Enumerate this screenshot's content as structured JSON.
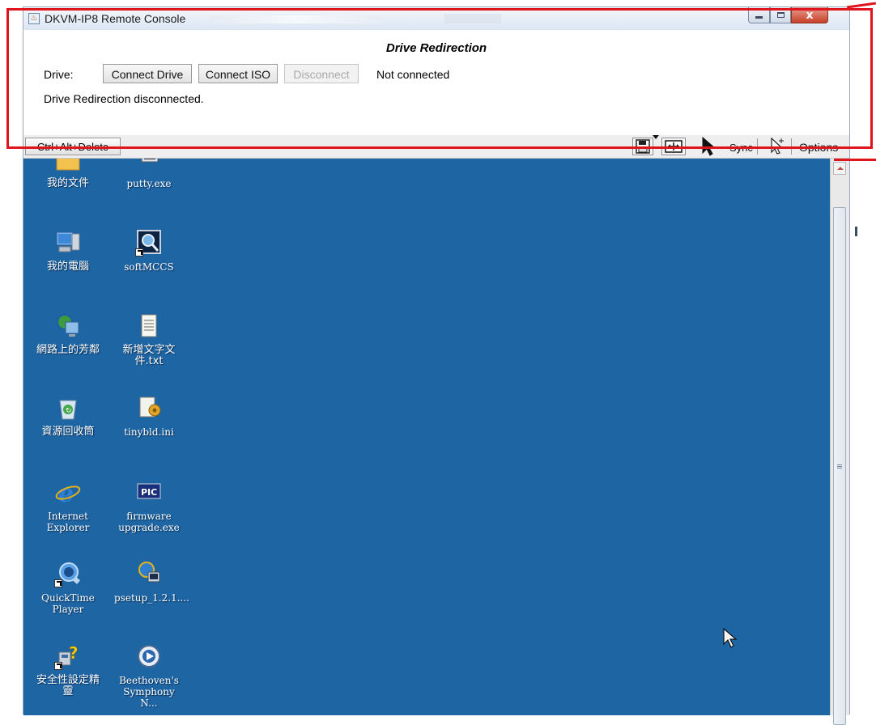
{
  "window": {
    "title": "DKVM-IP8 Remote Console",
    "controls": [
      "minimize",
      "maximize",
      "close"
    ]
  },
  "drive_panel": {
    "title": "Drive Redirection",
    "drive_label": "Drive:",
    "buttons": {
      "connect_drive": "Connect Drive",
      "connect_iso": "Connect ISO",
      "disconnect": "Disconnect"
    },
    "status": "Not connected",
    "message": "Drive Redirection disconnected."
  },
  "toolbar": {
    "ctrl_alt_delete": "Ctrl+Alt+Delete",
    "sync_label": "Sync",
    "options_label": "Options",
    "icons": [
      "floppy-save-icon",
      "fit-screen-icon",
      "pointer-icon",
      "pointer-outline-icon"
    ]
  },
  "desktop": {
    "background_color": "#1e65a4",
    "icons": [
      {
        "label": "我的文件",
        "icon": "folder-icon"
      },
      {
        "label": "putty.exe",
        "icon": "putty-icon"
      },
      {
        "label": "我的電腦",
        "icon": "computer-icon"
      },
      {
        "label": "softMCCS",
        "icon": "magnifier-app-icon"
      },
      {
        "label": "網路上的芳鄰",
        "icon": "network-icon"
      },
      {
        "label": "新增文字文件.txt",
        "icon": "text-file-icon"
      },
      {
        "label": "資源回收筒",
        "icon": "recycle-bin-icon"
      },
      {
        "label": "tinybld.ini",
        "icon": "ini-file-icon"
      },
      {
        "label": "Internet Explorer",
        "icon": "ie-icon"
      },
      {
        "label": "firmware upgrade.exe",
        "icon": "pic-chip-icon"
      },
      {
        "label": "QuickTime Player",
        "icon": "quicktime-icon"
      },
      {
        "label": "psetup_1.2.1....",
        "icon": "setup-globe-icon"
      },
      {
        "label": "安全性設定精靈",
        "icon": "security-wizard-icon"
      },
      {
        "label": "Beethoven's Symphony N...",
        "icon": "media-file-icon"
      }
    ]
  },
  "annotation": {
    "color": "#e0141c"
  }
}
